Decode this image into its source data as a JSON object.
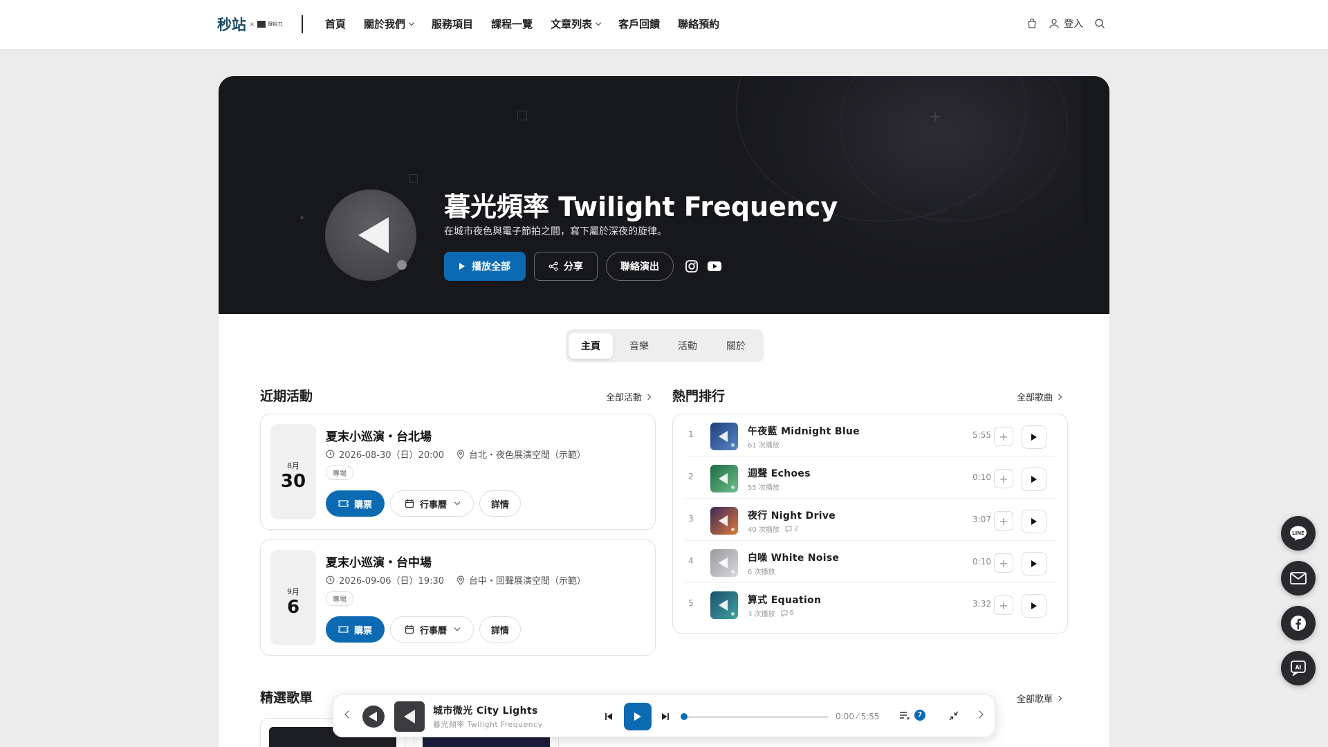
{
  "nav": {
    "logo_main": "秒站",
    "logo_x": "×",
    "logo_sub": "肆拾刀",
    "items": [
      {
        "label": "首頁"
      },
      {
        "label": "關於我們"
      },
      {
        "label": "服務項目"
      },
      {
        "label": "課程一覽"
      },
      {
        "label": "文章列表"
      },
      {
        "label": "客戶回饋"
      },
      {
        "label": "聯絡預約"
      }
    ],
    "login_label": "登入"
  },
  "hero": {
    "title": "暮光頻率 Twilight Frequency",
    "subtitle": "在城市夜色與電子節拍之間，寫下屬於深夜的旋律。",
    "play_all_label": "播放全部",
    "share_label": "分享",
    "contact_label": "聯絡演出"
  },
  "tabs": [
    {
      "label": "主頁"
    },
    {
      "label": "音樂"
    },
    {
      "label": "活動"
    },
    {
      "label": "關於"
    }
  ],
  "events_section": {
    "title": "近期活動",
    "link_label": "全部活動",
    "events": [
      {
        "month": "8月",
        "day": "30",
        "title": "夏末小巡演・台北場",
        "datetime": "2026-08-30（日）20:00",
        "venue": "台北・夜色展演空間（示範）",
        "tag": "專場",
        "buy_label": "購票",
        "calendar_label": "行事曆",
        "detail_label": "詳情"
      },
      {
        "month": "9月",
        "day": "6",
        "title": "夏末小巡演・台中場",
        "datetime": "2026-09-06（日）19:30",
        "venue": "台中・回聲展演空間（示範）",
        "tag": "專場",
        "buy_label": "購票",
        "calendar_label": "行事曆",
        "detail_label": "詳情"
      }
    ]
  },
  "ranking_section": {
    "title": "熱門排行",
    "link_label": "全部歌曲",
    "tracks": [
      {
        "rank": "1",
        "title": "午夜藍 Midnight Blue",
        "plays": "61 次播放",
        "comments": "",
        "duration": "5:55",
        "thumb_from": "#1f3f7a",
        "thumb_to": "#5a86c9"
      },
      {
        "rank": "2",
        "title": "迴聲 Echoes",
        "plays": "55 次播放",
        "comments": "",
        "duration": "0:10",
        "thumb_from": "#1d6b43",
        "thumb_to": "#6fbf8a"
      },
      {
        "rank": "3",
        "title": "夜行 Night Drive",
        "plays": "40 次播放",
        "comments": "2",
        "duration": "3:07",
        "thumb_from": "#3a2a5a",
        "thumb_to": "#e07a3a"
      },
      {
        "rank": "4",
        "title": "白噪 White Noise",
        "plays": "6 次播放",
        "comments": "",
        "duration": "0:10",
        "thumb_from": "#9a9a9e",
        "thumb_to": "#d8d8dc"
      },
      {
        "rank": "5",
        "title": "算式 Equation",
        "plays": "3 次播放",
        "comments": "6",
        "duration": "3:32",
        "thumb_from": "#1d4f6e",
        "thumb_to": "#3fa3a0"
      }
    ]
  },
  "playlists_section": {
    "title": "精選歌單",
    "link_label": "全部歌單"
  },
  "player": {
    "track_title": "城市微光 City Lights",
    "artist": "暮光頻率 Twilight Frequency",
    "time": "0:00 ⁄ 5:55",
    "progress": 0,
    "queue_count": "7"
  },
  "colors": {
    "accent": "#0c6ab3",
    "hero_bg": "#17181c",
    "page_bg": "#ececec"
  },
  "floating": [
    {
      "icon": "line-icon"
    },
    {
      "icon": "mail-icon"
    },
    {
      "icon": "facebook-icon"
    },
    {
      "icon": "ai-chat-icon"
    }
  ]
}
